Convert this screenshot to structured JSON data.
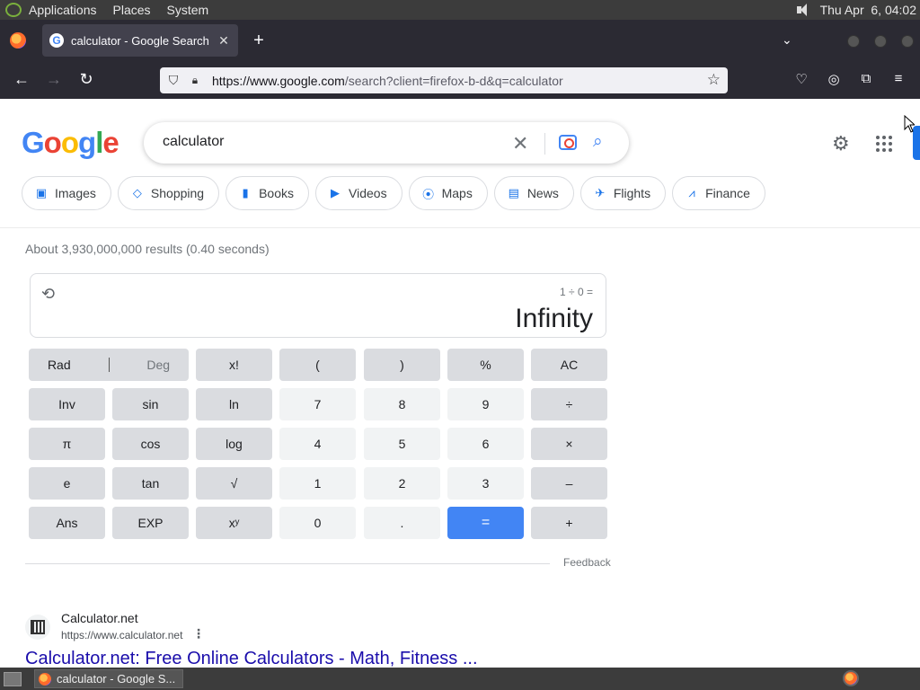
{
  "top_panel": {
    "menus": [
      "Applications",
      "Places",
      "System"
    ],
    "clock": "Thu Apr  6, 04:02"
  },
  "browser": {
    "tab_title": "calculator - Google Search",
    "favicon_letter": "G",
    "url_host": "https://www.google.com",
    "url_rest": "/search?client=firefox-b-d&q=calculator"
  },
  "google": {
    "logo": [
      "G",
      "o",
      "o",
      "g",
      "l",
      "e"
    ],
    "logo_colors": [
      "#4285f4",
      "#ea4335",
      "#fbbc05",
      "#4285f4",
      "#34a853",
      "#ea4335"
    ],
    "query": "calculator",
    "chips": [
      {
        "label": "Images",
        "icon": "image-icon"
      },
      {
        "label": "Shopping",
        "icon": "tag-icon"
      },
      {
        "label": "Books",
        "icon": "book-icon"
      },
      {
        "label": "Videos",
        "icon": "video-icon"
      },
      {
        "label": "Maps",
        "icon": "map-pin-icon"
      },
      {
        "label": "News",
        "icon": "news-icon"
      },
      {
        "label": "Flights",
        "icon": "plane-icon"
      },
      {
        "label": "Finance",
        "icon": "finance-icon"
      }
    ],
    "stats": "About 3,930,000,000 results (0.40 seconds)"
  },
  "calculator": {
    "expression": "1 ÷ 0 =",
    "result": "Infinity",
    "rad": "Rad",
    "deg": "Deg",
    "keys": [
      [
        "x!",
        "(",
        ")",
        "%",
        "AC"
      ],
      [
        "Inv",
        "sin",
        "ln",
        "7",
        "8",
        "9",
        "÷"
      ],
      [
        "π",
        "cos",
        "log",
        "4",
        "5",
        "6",
        "×"
      ],
      [
        "e",
        "tan",
        "√",
        "1",
        "2",
        "3",
        "–"
      ],
      [
        "Ans",
        "EXP",
        "xʸ",
        "0",
        ".",
        "=",
        "+"
      ]
    ],
    "feedback": "Feedback"
  },
  "result": {
    "site_name": "Calculator.net",
    "url": "https://www.calculator.net",
    "title": "Calculator.net: Free Online Calculators - Math, Fitness ..."
  },
  "taskbar": {
    "task_label": "calculator - Google S..."
  },
  "colors": {
    "accent": "#4285f4",
    "link": "#1a0dab"
  }
}
